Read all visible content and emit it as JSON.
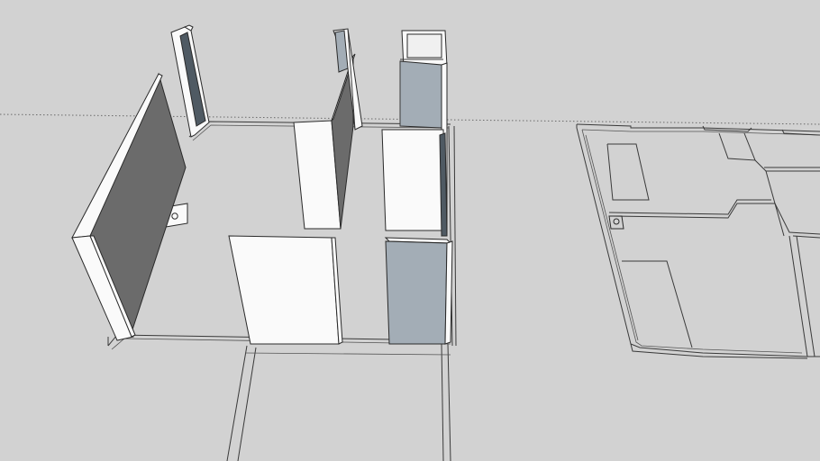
{
  "scene": {
    "background_color": "#d2d2d2",
    "wall_colors": {
      "front": "#fafafa",
      "shadow": "#6b6b6b",
      "blue_side": "#a3adb6",
      "slate": "#4f5a63"
    },
    "edge_color": "#2a2a2a"
  }
}
